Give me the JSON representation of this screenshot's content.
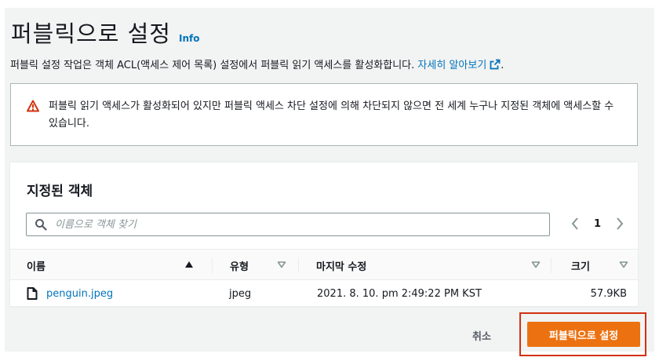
{
  "header": {
    "title": "퍼블릭으로 설정",
    "info_label": "Info"
  },
  "description": {
    "text": "퍼블릭 설정 작업은 객체 ACL(액세스 제어 목록) 설정에서 퍼블릭 읽기 액세스를 활성화합니다. ",
    "link_label": "자세히 알아보기",
    "trailing": "."
  },
  "alert": {
    "icon": "warning-icon",
    "text": "퍼블릭 읽기 액세스가 활성화되어 있지만 퍼블릭 액세스 차단 설정에 의해 차단되지 않으면 전 세계 누구나 지정된 객체에 액세스할 수 있습니다."
  },
  "objects_panel": {
    "title": "지정된 객체",
    "search_placeholder": "이름으로 객체 찾기",
    "current_page": "1",
    "columns": [
      {
        "label": "이름",
        "sort": "ascending"
      },
      {
        "label": "유형",
        "sort": "none"
      },
      {
        "label": "마지막 수정",
        "sort": "none"
      },
      {
        "label": "크기",
        "sort": "none"
      }
    ],
    "rows": [
      {
        "name": "penguin.jpeg",
        "type": "jpeg",
        "last_modified": "2021. 8. 10. pm 2:49:22 PM KST",
        "size": "57.9KB"
      }
    ]
  },
  "footer": {
    "cancel_label": "취소",
    "primary_label": "퍼블릭으로 설정"
  },
  "colors": {
    "accent": "#ec7211",
    "link": "#0073bb",
    "warning": "#d13212",
    "highlight_box": "#d13212"
  }
}
